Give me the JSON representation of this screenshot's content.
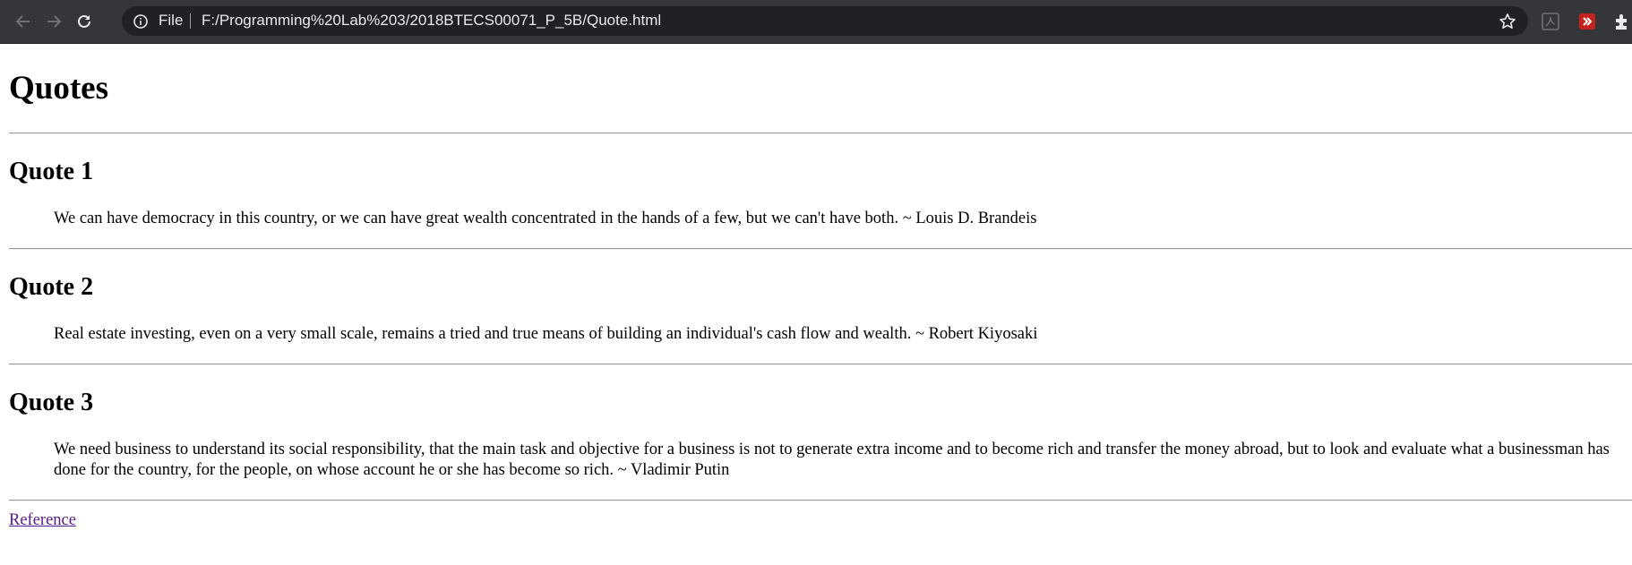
{
  "browser": {
    "address_scheme": "File",
    "address_url": "F:/Programming%20Lab%203/2018BTECS00071_P_5B/Quote.html",
    "colors": {
      "toolbar": "#35363a",
      "omnibox": "#202124",
      "text": "#e8eaed"
    },
    "icons": [
      "back-arrow-icon",
      "forward-arrow-icon",
      "reload-icon",
      "info-icon",
      "star-icon",
      "pdf-extension-icon",
      "red-extension-icon",
      "puzzle-extensions-icon"
    ]
  },
  "page": {
    "heading": "Quotes",
    "quotes": [
      {
        "title": "Quote 1",
        "text": "We can have democracy in this country, or we can have great wealth concentrated in the hands of a few, but we can't have both. ~ Louis D. Brandeis"
      },
      {
        "title": "Quote 2",
        "text": "Real estate investing, even on a very small scale, remains a tried and true means of building an individual's cash flow and wealth. ~ Robert Kiyosaki"
      },
      {
        "title": "Quote 3",
        "text": "We need business to understand its social responsibility, that the main task and objective for a business is not to generate extra income and to become rich and transfer the money abroad, but to look and evaluate what a businessman has done for the country, for the people, on whose account he or she has become so rich. ~ Vladimir Putin"
      }
    ],
    "reference_link": "Reference",
    "link_color": "#551a8b"
  }
}
